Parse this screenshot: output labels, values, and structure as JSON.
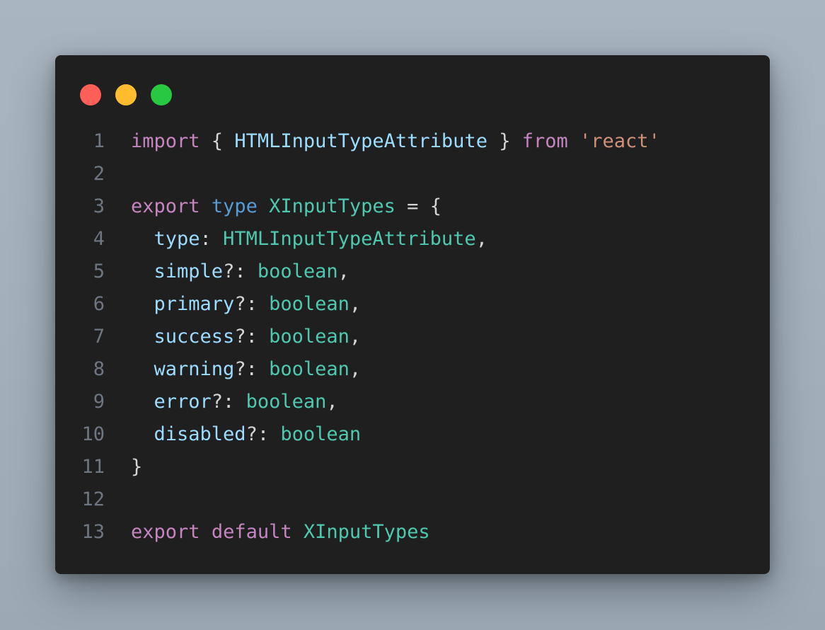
{
  "window": {
    "controls": [
      {
        "name": "close",
        "color": "#ff5f57"
      },
      {
        "name": "minimize",
        "color": "#febc2e"
      },
      {
        "name": "maximize",
        "color": "#28c840"
      }
    ]
  },
  "colors": {
    "keyword": "#c586c0",
    "type_keyword": "#569cd6",
    "type": "#4ec9b0",
    "property": "#9cdcfe",
    "string": "#ce9178",
    "punctuation": "#d4d4d4",
    "line_number": "#6e7681"
  },
  "code": {
    "language": "typescript",
    "lines": [
      {
        "number": "1",
        "tokens": [
          {
            "text": "import",
            "kind": "keyword"
          },
          {
            "text": " { ",
            "kind": "punctuation"
          },
          {
            "text": "HTMLInputTypeAttribute",
            "kind": "property"
          },
          {
            "text": " } ",
            "kind": "punctuation"
          },
          {
            "text": "from",
            "kind": "keyword"
          },
          {
            "text": " ",
            "kind": "punctuation"
          },
          {
            "text": "'react'",
            "kind": "string"
          }
        ]
      },
      {
        "number": "2",
        "tokens": []
      },
      {
        "number": "3",
        "tokens": [
          {
            "text": "export",
            "kind": "keyword"
          },
          {
            "text": " ",
            "kind": "punctuation"
          },
          {
            "text": "type",
            "kind": "type_keyword"
          },
          {
            "text": " ",
            "kind": "punctuation"
          },
          {
            "text": "XInputTypes",
            "kind": "type"
          },
          {
            "text": " = {",
            "kind": "punctuation"
          }
        ]
      },
      {
        "number": "4",
        "tokens": [
          {
            "text": "  ",
            "kind": "punctuation"
          },
          {
            "text": "type",
            "kind": "property"
          },
          {
            "text": ": ",
            "kind": "punctuation"
          },
          {
            "text": "HTMLInputTypeAttribute",
            "kind": "type"
          },
          {
            "text": ",",
            "kind": "punctuation"
          }
        ]
      },
      {
        "number": "5",
        "tokens": [
          {
            "text": "  ",
            "kind": "punctuation"
          },
          {
            "text": "simple",
            "kind": "property"
          },
          {
            "text": "?: ",
            "kind": "punctuation"
          },
          {
            "text": "boolean",
            "kind": "type"
          },
          {
            "text": ",",
            "kind": "punctuation"
          }
        ]
      },
      {
        "number": "6",
        "tokens": [
          {
            "text": "  ",
            "kind": "punctuation"
          },
          {
            "text": "primary",
            "kind": "property"
          },
          {
            "text": "?: ",
            "kind": "punctuation"
          },
          {
            "text": "boolean",
            "kind": "type"
          },
          {
            "text": ",",
            "kind": "punctuation"
          }
        ]
      },
      {
        "number": "7",
        "tokens": [
          {
            "text": "  ",
            "kind": "punctuation"
          },
          {
            "text": "success",
            "kind": "property"
          },
          {
            "text": "?: ",
            "kind": "punctuation"
          },
          {
            "text": "boolean",
            "kind": "type"
          },
          {
            "text": ",",
            "kind": "punctuation"
          }
        ]
      },
      {
        "number": "8",
        "tokens": [
          {
            "text": "  ",
            "kind": "punctuation"
          },
          {
            "text": "warning",
            "kind": "property"
          },
          {
            "text": "?: ",
            "kind": "punctuation"
          },
          {
            "text": "boolean",
            "kind": "type"
          },
          {
            "text": ",",
            "kind": "punctuation"
          }
        ]
      },
      {
        "number": "9",
        "tokens": [
          {
            "text": "  ",
            "kind": "punctuation"
          },
          {
            "text": "error",
            "kind": "property"
          },
          {
            "text": "?: ",
            "kind": "punctuation"
          },
          {
            "text": "boolean",
            "kind": "type"
          },
          {
            "text": ",",
            "kind": "punctuation"
          }
        ]
      },
      {
        "number": "10",
        "tokens": [
          {
            "text": "  ",
            "kind": "punctuation"
          },
          {
            "text": "disabled",
            "kind": "property"
          },
          {
            "text": "?: ",
            "kind": "punctuation"
          },
          {
            "text": "boolean",
            "kind": "type"
          }
        ]
      },
      {
        "number": "11",
        "tokens": [
          {
            "text": "}",
            "kind": "punctuation"
          }
        ]
      },
      {
        "number": "12",
        "tokens": []
      },
      {
        "number": "13",
        "tokens": [
          {
            "text": "export",
            "kind": "keyword"
          },
          {
            "text": " ",
            "kind": "punctuation"
          },
          {
            "text": "default",
            "kind": "keyword"
          },
          {
            "text": " ",
            "kind": "punctuation"
          },
          {
            "text": "XInputTypes",
            "kind": "type"
          }
        ]
      }
    ]
  }
}
